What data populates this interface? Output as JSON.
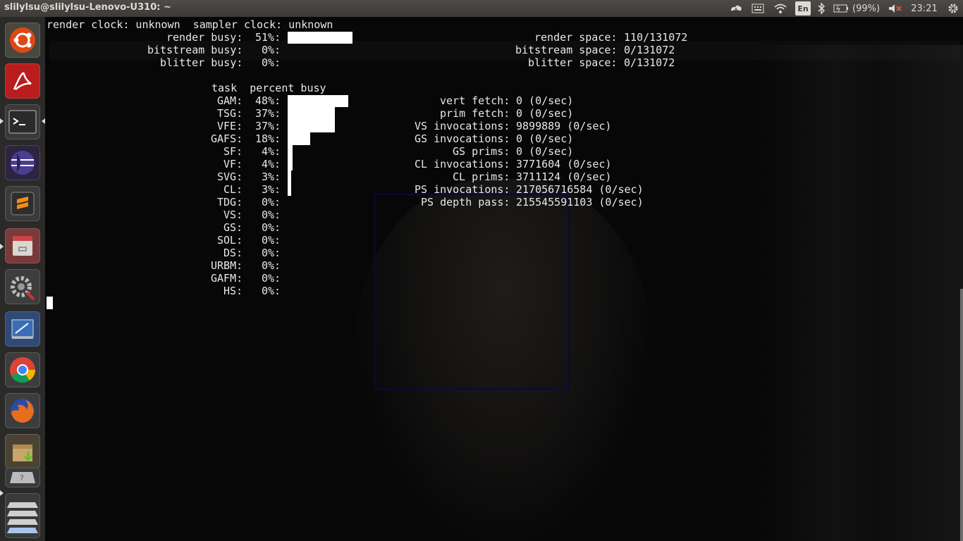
{
  "panel": {
    "window_title": "slilylsu@slilylsu-Lenovo-U310: ~",
    "keyboard_layout": "En",
    "battery_percent": "(99%)",
    "clock": "23:21"
  },
  "launcher": {
    "items": [
      "ubuntu-dash",
      "adobe-reader",
      "terminal",
      "eclipse",
      "sublime-text",
      "file-manager",
      "system-settings",
      "screenshot-tool",
      "chrome",
      "firefox",
      "archive-installer",
      "unknown-app",
      "workspace-switcher"
    ]
  },
  "terminal": {
    "line_clock": "render clock: unknown  sampler clock: unknown",
    "engines": [
      {
        "label": "render busy:",
        "pct": "51%:",
        "value": 51
      },
      {
        "label": "bitstream busy:",
        "pct": "0%:",
        "value": 0
      },
      {
        "label": "blitter busy:",
        "pct": "0%:",
        "value": 0
      }
    ],
    "spaces": [
      {
        "label": "render space:",
        "value": "110/131072"
      },
      {
        "label": "bitstream space:",
        "value": "0/131072"
      },
      {
        "label": "blitter space:",
        "value": "0/131072"
      }
    ],
    "task_header_task": "task",
    "task_header_percent": "percent busy",
    "tasks": [
      {
        "name": "GAM:",
        "pct": "48%:",
        "value": 48
      },
      {
        "name": "TSG:",
        "pct": "37%:",
        "value": 37
      },
      {
        "name": "VFE:",
        "pct": "37%:",
        "value": 37
      },
      {
        "name": "GAFS:",
        "pct": "18%:",
        "value": 18
      },
      {
        "name": "SF:",
        "pct": "4%:",
        "value": 4
      },
      {
        "name": "VF:",
        "pct": "4%:",
        "value": 4
      },
      {
        "name": "SVG:",
        "pct": "3%:",
        "value": 3
      },
      {
        "name": "CL:",
        "pct": "3%:",
        "value": 3
      },
      {
        "name": "TDG:",
        "pct": "0%:",
        "value": 0
      },
      {
        "name": "VS:",
        "pct": "0%:",
        "value": 0
      },
      {
        "name": "GS:",
        "pct": "0%:",
        "value": 0
      },
      {
        "name": "SOL:",
        "pct": "0%:",
        "value": 0
      },
      {
        "name": "DS:",
        "pct": "0%:",
        "value": 0
      },
      {
        "name": "URBM:",
        "pct": "0%:",
        "value": 0
      },
      {
        "name": "GAFM:",
        "pct": "0%:",
        "value": 0
      },
      {
        "name": "HS:",
        "pct": "0%:",
        "value": 0
      }
    ],
    "stats": [
      {
        "label": "vert fetch:",
        "value": "0 (0/sec)"
      },
      {
        "label": "prim fetch:",
        "value": "0 (0/sec)"
      },
      {
        "label": "VS invocations:",
        "value": "9899889 (0/sec)"
      },
      {
        "label": "GS invocations:",
        "value": "0 (0/sec)"
      },
      {
        "label": "GS prims:",
        "value": "0 (0/sec)"
      },
      {
        "label": "CL invocations:",
        "value": "3771604 (0/sec)"
      },
      {
        "label": "CL prims:",
        "value": "3711124 (0/sec)"
      },
      {
        "label": "PS invocations:",
        "value": "217056716584 (0/sec)"
      },
      {
        "label": "PS depth pass:",
        "value": "215545591103 (0/sec)"
      }
    ]
  },
  "colors": {
    "panel_bg": "#3c3b37",
    "launcher_bg": "#2a2a28",
    "terminal_fg": "#e8e8e8",
    "bar_color": "#ffffff",
    "mute_red": "#e0504a"
  }
}
